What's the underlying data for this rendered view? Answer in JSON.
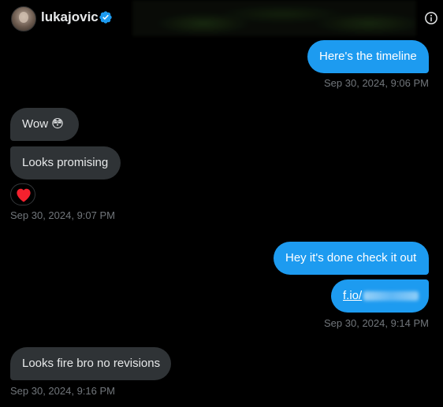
{
  "header": {
    "username": "lukajovic",
    "verified_icon": "verified-badge-icon",
    "info_icon": "info-icon"
  },
  "messages": [
    {
      "id": "m1",
      "direction": "outgoing",
      "text": "Here's the timeline"
    },
    {
      "id": "t1",
      "timestamp": "Sep 30, 2024, 9:06 PM"
    },
    {
      "id": "m2",
      "direction": "incoming",
      "text": "Wow 😳"
    },
    {
      "id": "m3",
      "direction": "incoming",
      "text": "Looks promising",
      "reaction": "heart"
    },
    {
      "id": "t2",
      "timestamp": "Sep 30, 2024, 9:07 PM"
    },
    {
      "id": "m4",
      "direction": "outgoing",
      "text": "Hey it's done check it out"
    },
    {
      "id": "m5",
      "direction": "outgoing",
      "link_text": "f.io/"
    },
    {
      "id": "t3",
      "timestamp": "Sep 30, 2024, 9:14 PM"
    },
    {
      "id": "m6",
      "direction": "incoming",
      "text": "Looks fire bro no revisions"
    },
    {
      "id": "t4",
      "timestamp": "Sep 30, 2024, 9:16 PM"
    }
  ],
  "colors": {
    "background": "#000000",
    "outgoing_bubble": "#1d9bf0",
    "incoming_bubble": "#2f3336",
    "timestamp_text": "#71767b",
    "verified": "#1d9bf0",
    "reaction_heart": "#f91880"
  }
}
